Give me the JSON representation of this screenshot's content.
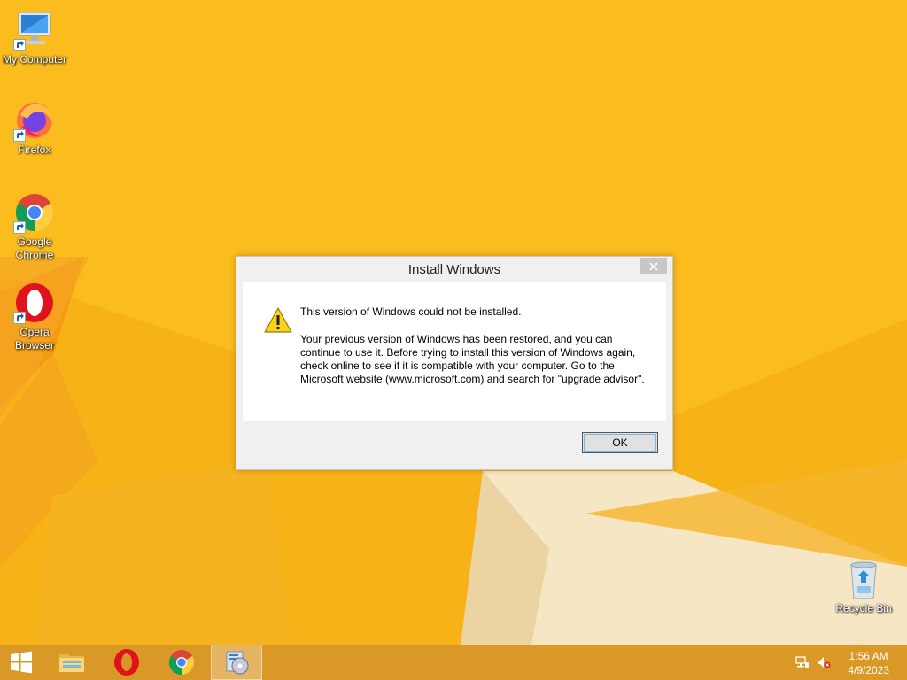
{
  "desktop": {
    "icons": [
      {
        "label": "My Computer",
        "icon": "computer-icon"
      },
      {
        "label": "Firefox",
        "icon": "firefox-icon"
      },
      {
        "label": "Google Chrome",
        "icon": "chrome-icon"
      },
      {
        "label": "Opera Browser",
        "icon": "opera-icon"
      },
      {
        "label": "Recycle Bin",
        "icon": "recycle-bin-icon"
      }
    ]
  },
  "dialog": {
    "title": "Install Windows",
    "main_instruction": "This version of Windows could not be installed.",
    "detail": "Your previous version of Windows has been restored, and you can continue to use it.  Before trying to install this version of Windows again, check online to see if it is compatible with your computer.  Go to the Microsoft website (www.microsoft.com) and search for \"upgrade advisor\".",
    "ok_label": "OK",
    "icon": "warning-icon"
  },
  "taskbar": {
    "items": [
      {
        "name": "start",
        "icon": "windows-logo-icon"
      },
      {
        "name": "file-explorer",
        "icon": "folder-icon"
      },
      {
        "name": "opera",
        "icon": "opera-icon"
      },
      {
        "name": "chrome",
        "icon": "chrome-icon"
      },
      {
        "name": "setup",
        "icon": "setup-icon",
        "active": true
      }
    ],
    "tray": {
      "network_icon": "network-icon",
      "volume_icon": "volume-muted-icon"
    },
    "clock": {
      "time": "1:56 AM",
      "date": "4/9/2023"
    }
  },
  "colors": {
    "wallpaper": "#f7b218",
    "taskbar": "#d79628",
    "dialog_bg": "#f0f0f0"
  }
}
